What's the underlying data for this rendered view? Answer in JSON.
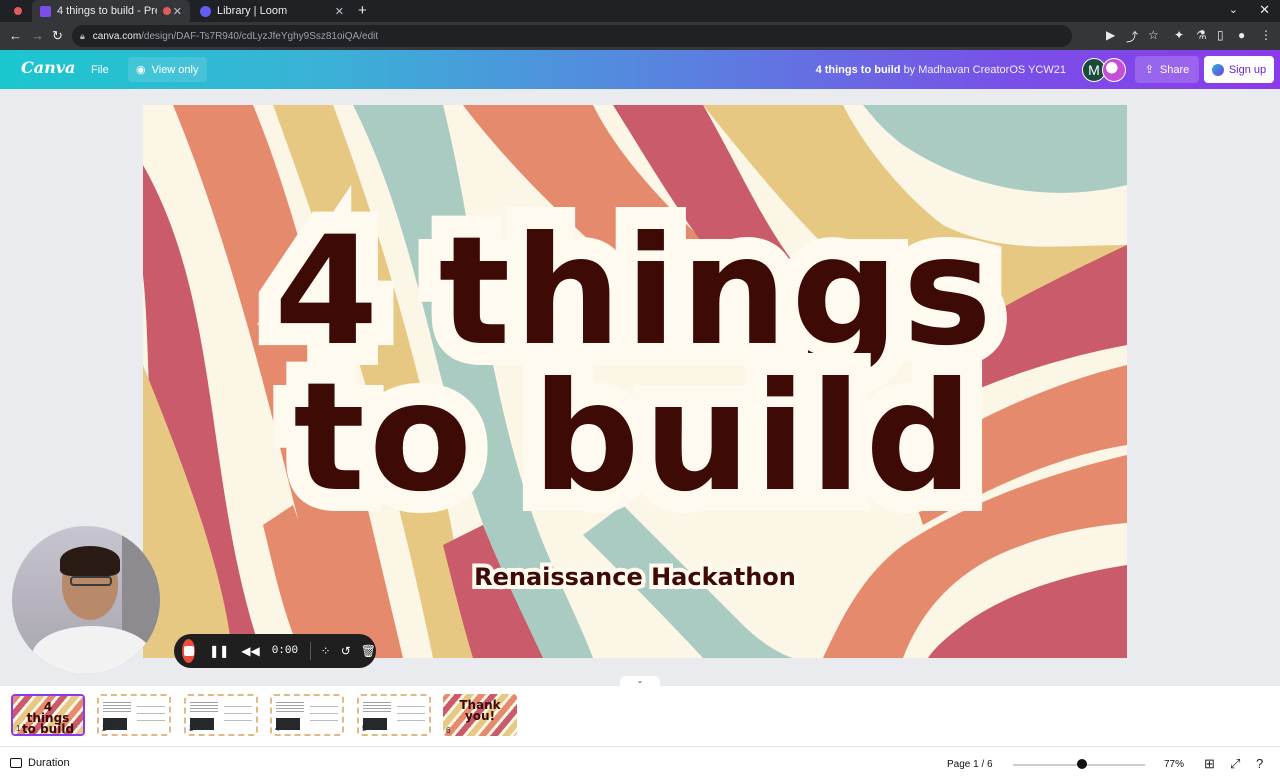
{
  "browser": {
    "tabs": [
      {
        "label": "4 things to build - Pre"
      },
      {
        "label": "Library | Loom"
      }
    ],
    "url_host": "canva.com",
    "url_path": "/design/DAF-Ts7R940/cdLyzJfeYghy9Ssz81oiQA/edit"
  },
  "header": {
    "logo": "Canva",
    "file_label": "File",
    "view_only_label": "View only",
    "doc_title": "4 things to build",
    "doc_by": "by Madhavan CreatorOS YCW21",
    "avatar_initial": "M",
    "share_label": "Share",
    "signup_label": "Sign up",
    "accent_color": "#8b3be9"
  },
  "slide": {
    "title_line1": "4 things",
    "title_line2": "to build",
    "subtitle": "Renaissance Hackathon",
    "text_color": "#3e0a06",
    "palette": [
      "#e58a6c",
      "#c95b6a",
      "#e7c882",
      "#a9cbc2",
      "#fbf6e6"
    ]
  },
  "loom": {
    "timer": "0:00"
  },
  "filmstrip": {
    "pages": [
      {
        "num": "1",
        "title": "4 things to build"
      },
      {
        "num": "2"
      },
      {
        "num": "3"
      },
      {
        "num": "4"
      },
      {
        "num": "5"
      },
      {
        "num": "6",
        "title": "Thank you!"
      }
    ]
  },
  "footer": {
    "duration_label": "Duration",
    "page_indicator": "Page 1 / 6",
    "zoom": "77%",
    "zoom_fraction": 0.77
  }
}
